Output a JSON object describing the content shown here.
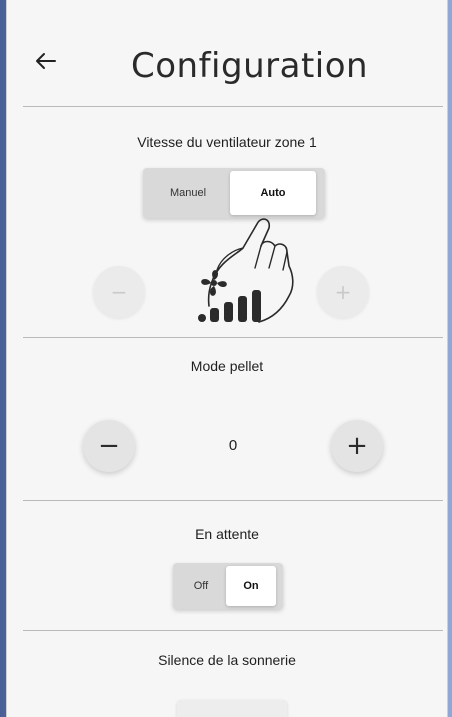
{
  "header": {
    "title": "Configuration"
  },
  "fan_zone1": {
    "label": "Vitesse du ventilateur zone 1",
    "options": [
      "Manuel",
      "Auto"
    ],
    "selected": "Auto",
    "minus": "−",
    "plus": "+"
  },
  "pellet_mode": {
    "label": "Mode pellet",
    "value": "0",
    "minus": "−",
    "plus": "+"
  },
  "standby": {
    "label": "En attente",
    "options": [
      "Off",
      "On"
    ],
    "selected": "On"
  },
  "ringer_silence": {
    "label": "Silence de la sonnerie"
  },
  "colors": {
    "panel_bg": "#f6f6f6",
    "divider": "#b9b9b9",
    "text": "#1f1f1f"
  },
  "icons": [
    "back-arrow-icon",
    "fan-icon",
    "speed-bars-icon",
    "touch-hand-icon"
  ]
}
